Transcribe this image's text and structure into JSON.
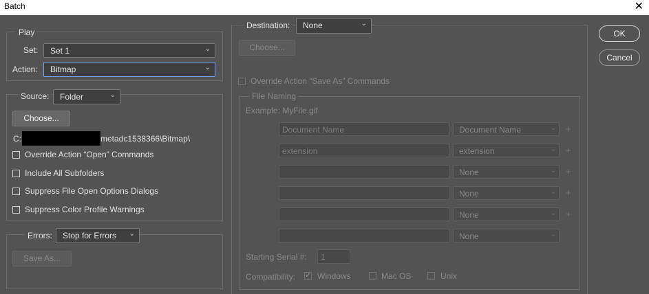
{
  "window": {
    "title": "Batch",
    "close_glyph": "✕"
  },
  "play": {
    "legend": "Play",
    "set_label": "Set:",
    "set_value": "Set 1",
    "action_label": "Action:",
    "action_value": "Bitmap"
  },
  "source": {
    "label": "Source:",
    "value": "Folder",
    "choose": "Choose...",
    "path_prefix": "C:",
    "path_suffix": "metadc1538366\\Bitmap\\",
    "options": [
      {
        "label": "Override Action “Open” Commands",
        "checked": false
      },
      {
        "label": "Include All Subfolders",
        "checked": false
      },
      {
        "label": "Suppress File Open Options Dialogs",
        "checked": false
      },
      {
        "label": "Suppress Color Profile Warnings",
        "checked": false
      }
    ]
  },
  "errors": {
    "label": "Errors:",
    "value": "Stop for Errors",
    "save_as": "Save As..."
  },
  "destination": {
    "label": "Destination:",
    "value": "None",
    "choose": "Choose...",
    "override": "Override Action “Save As” Commands"
  },
  "file_naming": {
    "legend": "File Naming",
    "example": "Example: MyFile.gif",
    "rows": [
      {
        "text": "Document Name",
        "select": "Document Name",
        "plus": "+"
      },
      {
        "text": "extension",
        "select": "extension",
        "plus": "+"
      },
      {
        "text": "",
        "select": "None",
        "plus": "+"
      },
      {
        "text": "",
        "select": "None",
        "plus": "+"
      },
      {
        "text": "",
        "select": "None",
        "plus": "+"
      },
      {
        "text": "",
        "select": "None",
        "plus": ""
      }
    ],
    "serial_label": "Starting Serial #:",
    "serial_value": "1",
    "compat_label": "Compatibility:",
    "compat": [
      {
        "label": "Windows",
        "checked": true
      },
      {
        "label": "Mac OS",
        "checked": false
      },
      {
        "label": "Unix",
        "checked": false
      }
    ]
  },
  "buttons": {
    "ok": "OK",
    "cancel": "Cancel"
  },
  "icons": {
    "chevron": "chevron-down-icon",
    "check": "checkmark-icon"
  },
  "colors": {
    "background": "#535353",
    "control": "#3f3f3f",
    "focus_border": "#6ea6ff"
  }
}
